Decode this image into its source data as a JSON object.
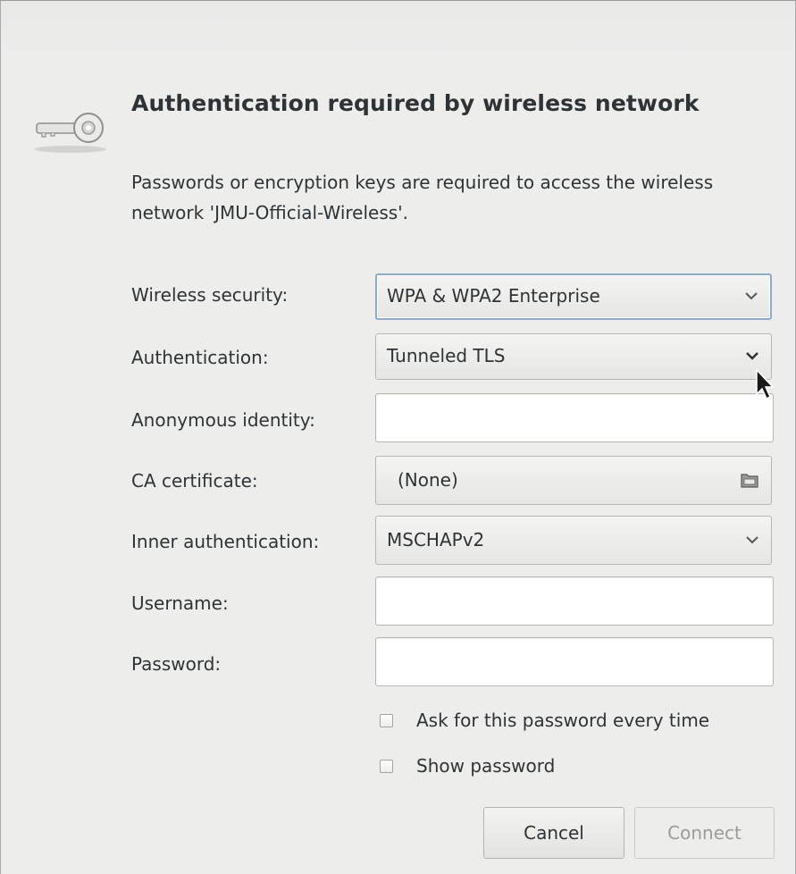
{
  "dialog": {
    "title": "Authentication required by wireless network",
    "description": "Passwords or encryption keys are required to access the wireless network 'JMU-Official-Wireless'.",
    "icon": "key-icon"
  },
  "fields": {
    "wireless_security": {
      "label": "Wireless security:",
      "value": "WPA & WPA2 Enterprise"
    },
    "authentication": {
      "label": "Authentication:",
      "value": "Tunneled TLS"
    },
    "anonymous_identity": {
      "label": "Anonymous identity:",
      "value": ""
    },
    "ca_certificate": {
      "label": "CA certificate:",
      "value": "(None)",
      "icon": "folder-icon"
    },
    "inner_authentication": {
      "label": "Inner authentication:",
      "value": "MSCHAPv2"
    },
    "username": {
      "label": "Username:",
      "value": ""
    },
    "password": {
      "label": "Password:",
      "value": ""
    }
  },
  "options": {
    "ask_password": {
      "label": "Ask for this password every time",
      "checked": false
    },
    "show_password": {
      "label": "Show password",
      "checked": false
    }
  },
  "buttons": {
    "cancel": "Cancel",
    "connect": "Connect"
  },
  "colors": {
    "dialog_bg": "#ededec",
    "text": "#2e3436",
    "focus_border": "#8fa9c9",
    "disabled_text": "#9a9d9a"
  }
}
